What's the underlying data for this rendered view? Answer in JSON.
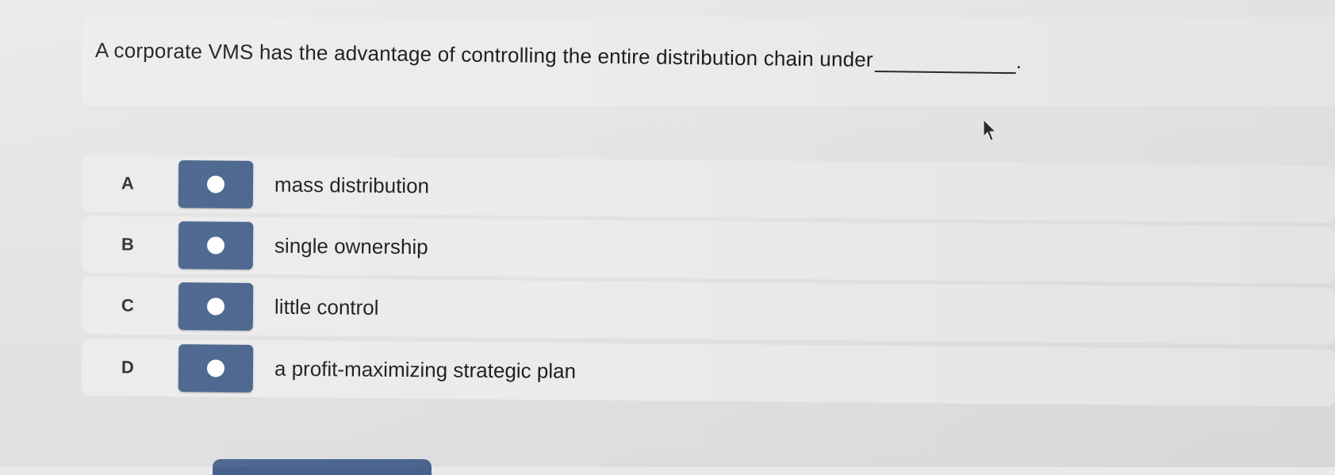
{
  "question": {
    "text": "A corporate VMS has the advantage of controlling the entire distribution chain under",
    "suffix": "."
  },
  "options": [
    {
      "letter": "A",
      "text": "mass distribution"
    },
    {
      "letter": "B",
      "text": "single ownership"
    },
    {
      "letter": "C",
      "text": "little control"
    },
    {
      "letter": "D",
      "text": "a profit-maximizing strategic plan"
    }
  ],
  "colors": {
    "option_box": "#47628c",
    "background": "#e6e6e6"
  },
  "icons": {
    "cursor": "mouse-pointer-icon",
    "radio": "radio-dot-icon"
  }
}
